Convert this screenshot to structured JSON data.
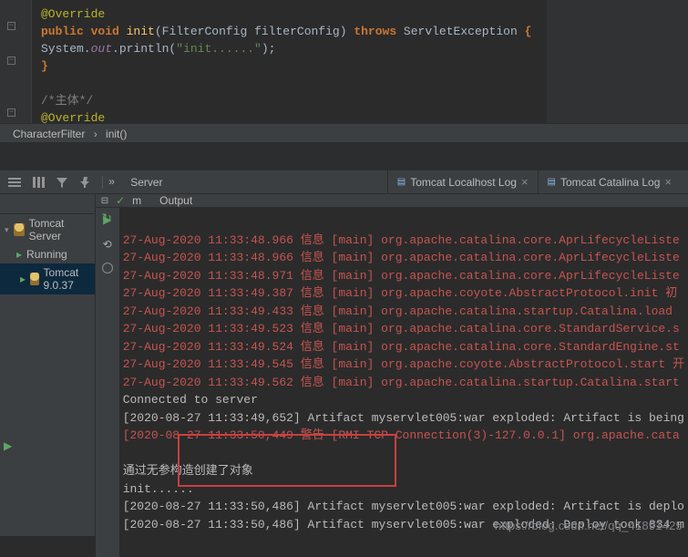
{
  "editor": {
    "line1": "@Override",
    "line2_kw1": "public void",
    "line2_meth": " init",
    "line2_paren1": "(",
    "line2_type1": "FilterConfig",
    "line2_space": " filterConfig) ",
    "line2_kw2": "throws",
    "line2_type2": " ServletException ",
    "line2_brace": "{",
    "line3_pre": "    System.",
    "line3_out": "out",
    "line3_mid": ".println(",
    "line3_str": "\"init......\"",
    "line3_end": ");",
    "line4": "}",
    "line6": "/*主体*/",
    "line7": "@Override"
  },
  "breadcrumb": {
    "item1": "CharacterFilter",
    "item2": "init()"
  },
  "toolbar": {
    "server_label": "Server",
    "output_label": "Output"
  },
  "tabs": {
    "localhost": "Tomcat Localhost Log",
    "catalina": "Tomcat Catalina Log"
  },
  "tree": {
    "root": "Tomcat Server",
    "running": "Running",
    "instance": "Tomcat 9.0.37"
  },
  "out_header": {
    "check": "✓",
    "m": "m"
  },
  "console": {
    "lines_red": [
      "27-Aug-2020 11:33:48.966 信息 [main] org.apache.catalina.core.AprLifecycleListe",
      "27-Aug-2020 11:33:48.966 信息 [main] org.apache.catalina.core.AprLifecycleListe",
      "27-Aug-2020 11:33:48.971 信息 [main] org.apache.catalina.core.AprLifecycleListe",
      "27-Aug-2020 11:33:49.387 信息 [main] org.apache.coyote.AbstractProtocol.init 初",
      "27-Aug-2020 11:33:49.433 信息 [main] org.apache.catalina.startup.Catalina.load ",
      "27-Aug-2020 11:33:49.523 信息 [main] org.apache.catalina.core.StandardService.s",
      "27-Aug-2020 11:33:49.524 信息 [main] org.apache.catalina.core.StandardEngine.st",
      "27-Aug-2020 11:33:49.545 信息 [main] org.apache.coyote.AbstractProtocol.start 开",
      "27-Aug-2020 11:33:49.562 信息 [main] org.apache.catalina.startup.Catalina.start"
    ],
    "connected": "Connected to server",
    "artifact1": "[2020-08-27 11:33:49,652] Artifact myservlet005:war exploded: Artifact is being",
    "warn": "[2020-08-27 11:33:50,449 警告 [RMI TCP Connection(3)-127.0.0.1] org.apache.cata",
    "msg1": "通过无参构造创建了对象",
    "msg2": "init......",
    "artifact2": "[2020-08-27 11:33:50,486] Artifact myservlet005:war exploded: Artifact is deplo",
    "artifact3": "[2020-08-27 11:33:50,486] Artifact myservlet005:war exploded: Deploy took 834 m"
  },
  "watermark": "https://blog.csdn.net/qq_41891425"
}
